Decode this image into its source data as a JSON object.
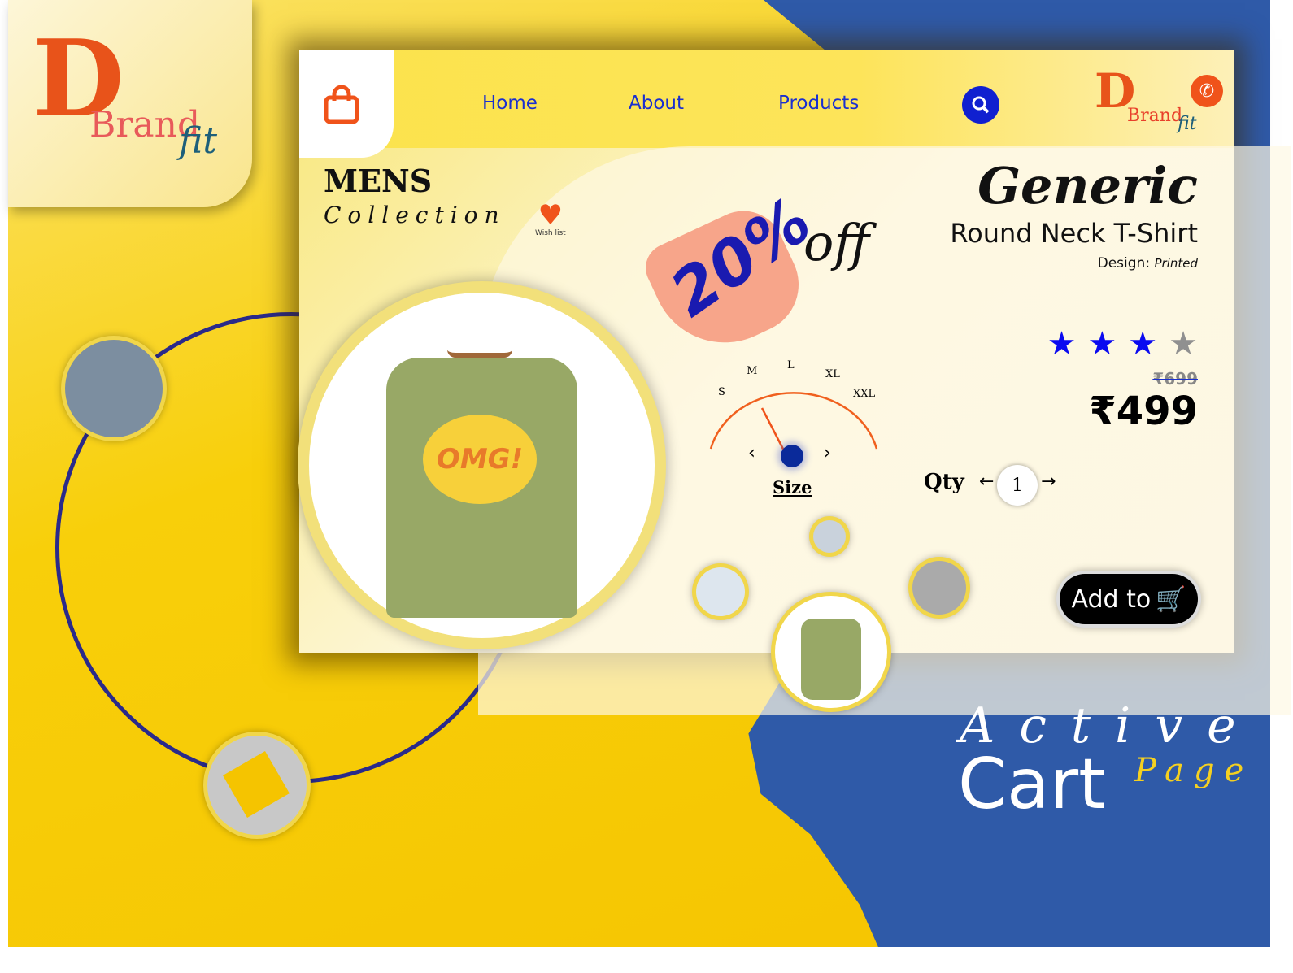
{
  "brand": {
    "letter": "D",
    "name": "Brand",
    "suffix": "fit"
  },
  "nav": {
    "items": [
      "Home",
      "About",
      "Products"
    ]
  },
  "collection": {
    "title": "MENS",
    "subtitle": "Collection"
  },
  "wishlist": {
    "label": "Wish list"
  },
  "discount": {
    "value": "20%",
    "suffix": "off"
  },
  "product": {
    "brand": "Generic",
    "name": "Round Neck T-Shirt",
    "design_label": "Design:",
    "design_value": "Printed",
    "rating": 3,
    "rating_max": 5,
    "old_price": "₹699",
    "price": "₹499",
    "shirt_text": "OMG!"
  },
  "size": {
    "options": [
      "S",
      "M",
      "L",
      "XL",
      "XXL"
    ],
    "selected": "M",
    "label": "Size"
  },
  "qty": {
    "label": "Qty",
    "value": "1"
  },
  "cart_button": {
    "label": "Add to"
  },
  "tagline": {
    "line1": "Active",
    "line2": "Cart",
    "line3": "Page"
  },
  "colors": {
    "accent": "#1020d0",
    "orange": "#f0531a",
    "yellow": "#f8cf0a",
    "blue": "#2f5aa8"
  }
}
